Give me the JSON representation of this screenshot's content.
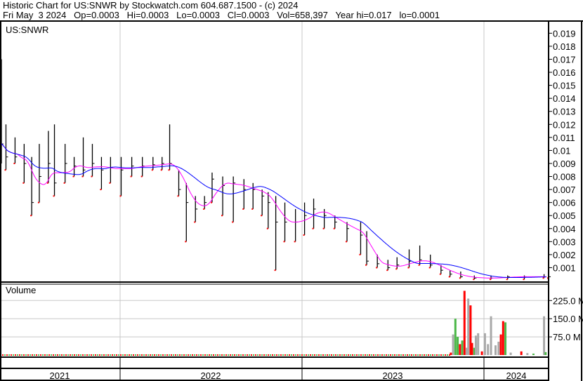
{
  "header": {
    "title": "Historic Chart for US:SNWR by Stockwatch.com 604.687.1500 - (c) 2024",
    "quote": "Fri May  3 2024   Op=0.0003   Hi=0.0003   Lo=0.0003   Cl=0.0003   Vol=658,397   Year hi=0.017   lo=0.0001"
  },
  "chart_data": [
    {
      "type": "line",
      "title": "US:SNWR",
      "x_unit": "months since May 2021",
      "xlim": [
        0,
        36.1
      ],
      "ylim": [
        0,
        0.0205
      ],
      "ytick_labels": [
        "0.001",
        "0.002",
        "0.003",
        "0.004",
        "0.005",
        "0.006",
        "0.007",
        "0.008",
        "0.009",
        "0.01",
        "0.011",
        "0.012",
        "0.013",
        "0.014",
        "0.015",
        "0.016",
        "0.017",
        "0.018",
        "0.019"
      ],
      "ticks": [
        0.001,
        0.002,
        0.003,
        0.004,
        0.005,
        0.006,
        0.007,
        0.008,
        0.009,
        0.01,
        0.011,
        0.012,
        0.013,
        0.014,
        0.015,
        0.016,
        0.017,
        0.018,
        0.019
      ],
      "bars": [
        [
          0,
          0.017,
          0.009,
          0.0105
        ],
        [
          0.3,
          0.012,
          0.0085,
          0.0095
        ],
        [
          0.9,
          0.011,
          0.009,
          0.0095
        ],
        [
          1.5,
          0.0105,
          0.0075,
          0.009
        ],
        [
          2,
          0.0095,
          0.005,
          0.006
        ],
        [
          2.5,
          0.0105,
          0.006,
          0.008
        ],
        [
          3.1,
          0.0115,
          0.0075,
          0.009
        ],
        [
          3.5,
          0.012,
          0.0065,
          0.0075
        ],
        [
          4.2,
          0.0105,
          0.0075,
          0.009
        ],
        [
          4.8,
          0.0095,
          0.008,
          0.0088
        ],
        [
          5.4,
          0.011,
          0.008,
          0.0085
        ],
        [
          6,
          0.0105,
          0.008,
          0.009
        ],
        [
          6.6,
          0.0095,
          0.007,
          0.0085
        ],
        [
          7.2,
          0.0095,
          0.0075,
          0.0087
        ],
        [
          7.9,
          0.0095,
          0.0065,
          0.0085
        ],
        [
          8.6,
          0.0095,
          0.008,
          0.0088
        ],
        [
          9.3,
          0.0095,
          0.008,
          0.0088
        ],
        [
          10,
          0.0095,
          0.0085,
          0.0089
        ],
        [
          10.6,
          0.0095,
          0.0085,
          0.009
        ],
        [
          11.1,
          0.012,
          0.0085,
          0.009
        ],
        [
          11.7,
          0.0085,
          0.0065,
          0.007
        ],
        [
          12.2,
          0.0075,
          0.003,
          0.006
        ],
        [
          12.8,
          0.0065,
          0.0045,
          0.0055
        ],
        [
          13.4,
          0.0065,
          0.0055,
          0.006
        ],
        [
          13.9,
          0.0083,
          0.006,
          0.0078
        ],
        [
          14.6,
          0.008,
          0.005,
          0.0073
        ],
        [
          15.3,
          0.008,
          0.0045,
          0.0075
        ],
        [
          16,
          0.0078,
          0.0055,
          0.007
        ],
        [
          16.6,
          0.0075,
          0.0055,
          0.007
        ],
        [
          17.2,
          0.007,
          0.005,
          0.0065
        ],
        [
          17.6,
          0.0068,
          0.004,
          0.006
        ],
        [
          18.1,
          0.0065,
          0.0008,
          0.0045
        ],
        [
          18.7,
          0.006,
          0.003,
          0.0045
        ],
        [
          19.4,
          0.0055,
          0.003,
          0.0045
        ],
        [
          20,
          0.006,
          0.0035,
          0.005
        ],
        [
          20.6,
          0.0063,
          0.004,
          0.0055
        ],
        [
          21.3,
          0.0055,
          0.004,
          0.005
        ],
        [
          22,
          0.005,
          0.004,
          0.0045
        ],
        [
          22.8,
          0.0045,
          0.003,
          0.004
        ],
        [
          23.7,
          0.0045,
          0.002,
          0.0035
        ],
        [
          24.1,
          0.0038,
          0.0012,
          0.0015
        ],
        [
          24.8,
          0.002,
          0.001,
          0.0013
        ],
        [
          25.5,
          0.0016,
          0.0008,
          0.001
        ],
        [
          26.1,
          0.0018,
          0.0009,
          0.0012
        ],
        [
          26.9,
          0.0024,
          0.001,
          0.0015
        ],
        [
          27.6,
          0.0027,
          0.0012,
          0.0016
        ],
        [
          28.3,
          0.002,
          0.001,
          0.0012
        ],
        [
          29,
          0.0012,
          0.0005,
          0.0008
        ],
        [
          29.6,
          0.0008,
          0.0003,
          0.0005
        ],
        [
          30.3,
          0.0007,
          0.0002,
          0.0003
        ],
        [
          31.2,
          0.0004,
          0.0001,
          0.0002
        ],
        [
          32.3,
          0.0004,
          0.0001,
          0.0002
        ],
        [
          33.4,
          0.0004,
          0.0001,
          0.0003
        ],
        [
          34.5,
          0.0004,
          0.0001,
          0.0003
        ],
        [
          35.8,
          0.0005,
          0.0002,
          0.0003
        ],
        [
          36.1,
          0.0004,
          0.0002,
          0.0003
        ]
      ],
      "series": [
        {
          "name": "short moving average",
          "color": "#ff00ff"
        },
        {
          "name": "long moving average",
          "color": "#0000ff"
        }
      ]
    },
    {
      "type": "bar",
      "title": "Volume",
      "xlim": [
        0,
        36.1
      ],
      "ylim": [
        0,
        300
      ],
      "ytick_labels": [
        "75.0 M",
        "150.0 M",
        "225.0 M"
      ],
      "ticks": [
        75,
        150,
        225
      ],
      "bars": [
        [
          29.65,
          10,
          "red"
        ],
        [
          29.8,
          85,
          "gray"
        ],
        [
          29.95,
          150,
          "green"
        ],
        [
          30.1,
          75,
          "green"
        ],
        [
          30.25,
          45,
          "red"
        ],
        [
          30.4,
          60,
          "green"
        ],
        [
          30.55,
          265,
          "red"
        ],
        [
          30.7,
          30,
          "gray"
        ],
        [
          30.8,
          233,
          "gray"
        ],
        [
          30.95,
          205,
          "red"
        ],
        [
          31.05,
          50,
          "red"
        ],
        [
          31.2,
          30,
          "green"
        ],
        [
          31.3,
          80,
          "gray"
        ],
        [
          31.45,
          90,
          "gray"
        ],
        [
          31.7,
          15,
          "red"
        ],
        [
          31.9,
          90,
          "gray"
        ],
        [
          32.1,
          45,
          "gray"
        ],
        [
          32.3,
          160,
          "gray"
        ],
        [
          32.6,
          40,
          "gray"
        ],
        [
          32.8,
          55,
          "gray"
        ],
        [
          32.95,
          85,
          "red"
        ],
        [
          33.1,
          140,
          "red"
        ],
        [
          33.25,
          135,
          "green"
        ],
        [
          33.6,
          10,
          "gray"
        ],
        [
          34.3,
          15,
          "red"
        ],
        [
          34.7,
          8,
          "gray"
        ],
        [
          35.1,
          6,
          "green"
        ],
        [
          35.8,
          160,
          "gray"
        ],
        [
          35.9,
          12,
          "green"
        ]
      ],
      "x_labels": [
        "2021",
        "2022",
        "2023",
        "2024"
      ]
    }
  ]
}
